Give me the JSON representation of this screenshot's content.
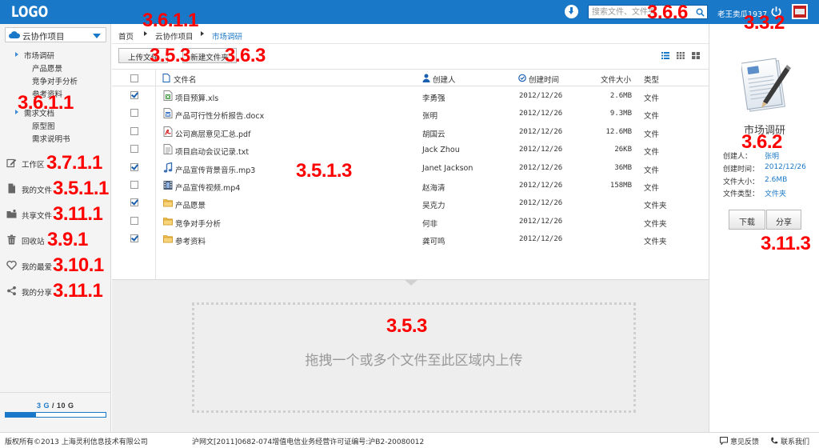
{
  "header": {
    "logo": "LOGO",
    "search_placeholder": "搜索文件、文件夹",
    "user_name": "老王卖瓜1937"
  },
  "sidebar": {
    "project_label": "云协作项目",
    "tree": [
      {
        "label": "市场调研",
        "expanded": true
      },
      {
        "label": "产品愿景"
      },
      {
        "label": "竞争对手分析"
      },
      {
        "label": "参考资料"
      },
      {
        "label": "需求文档",
        "expanded": false
      },
      {
        "label": "原型图"
      },
      {
        "label": "需求说明书"
      }
    ],
    "nav": [
      {
        "label": "工作区",
        "icon": "edit-icon"
      },
      {
        "label": "我的文件",
        "icon": "file-icon"
      },
      {
        "label": "共享文件",
        "icon": "shared-folder-icon"
      },
      {
        "label": "回收站",
        "icon": "trash-icon"
      },
      {
        "label": "我的最爱",
        "icon": "heart-icon"
      },
      {
        "label": "我的分享",
        "icon": "share-icon"
      }
    ],
    "quota_used": "3 G",
    "quota_sep": " / ",
    "quota_total": "10 G",
    "quota_fraction": 0.3
  },
  "breadcrumb": [
    "首页",
    "云协作项目",
    "市场调研"
  ],
  "toolbar": {
    "upload_label": "上传文件",
    "new_folder_label": "新建文件夹"
  },
  "table": {
    "headers": {
      "name": "文件名",
      "creator": "创建人",
      "created": "创建时间",
      "size": "文件大小",
      "type": "类型"
    },
    "rows": [
      {
        "checked": true,
        "icon": "xls",
        "name": "项目预算.xls",
        "creator": "李勇强",
        "date": "2012/12/26",
        "size": "2.6MB",
        "type": "文件"
      },
      {
        "checked": false,
        "icon": "docx",
        "name": "产品可行性分析报告.docx",
        "creator": "张明",
        "date": "2012/12/26",
        "size": "9.3MB",
        "type": "文件"
      },
      {
        "checked": false,
        "icon": "pdf",
        "name": "公司高层意见汇总.pdf",
        "creator": "胡国云",
        "date": "2012/12/26",
        "size": "12.6MB",
        "type": "文件"
      },
      {
        "checked": false,
        "icon": "txt",
        "name": "项目启动会议记录.txt",
        "creator": "Jack Zhou",
        "date": "2012/12/26",
        "size": "26KB",
        "type": "文件"
      },
      {
        "checked": true,
        "icon": "mp3",
        "name": "产品宣传背景音乐.mp3",
        "creator": "Janet Jackson",
        "date": "2012/12/26",
        "size": "36MB",
        "type": "文件"
      },
      {
        "checked": false,
        "icon": "mp4",
        "name": "产品宣传视频.mp4",
        "creator": "赵海清",
        "date": "2012/12/26",
        "size": "158MB",
        "type": "文件"
      },
      {
        "checked": true,
        "icon": "folder",
        "name": "产品愿景",
        "creator": "吴克力",
        "date": "2012/12/26",
        "size": "",
        "type": "文件夹"
      },
      {
        "checked": false,
        "icon": "folder",
        "name": "竞争对手分析",
        "creator": "何非",
        "date": "2012/12/26",
        "size": "",
        "type": "文件夹"
      },
      {
        "checked": true,
        "icon": "folder",
        "name": "参考资料",
        "creator": "龚可鸣",
        "date": "2012/12/26",
        "size": "",
        "type": "文件夹"
      }
    ]
  },
  "dropzone": {
    "text": "拖拽一个或多个文件至此区域内上传"
  },
  "details": {
    "title": "市场调研",
    "creator_label": "创建人：",
    "creator": "张明",
    "created_label": "创建时间：",
    "created": "2012/12/26",
    "size_label": "文件大小：",
    "size": "2.6MB",
    "type_label": "文件类型：",
    "type": "文件夹",
    "download_label": "下载",
    "share_label": "分享"
  },
  "footer": {
    "copyright": "版权所有©2013  上海灵利信息技术有限公司",
    "license": "沪网文[2011]0682-074增值电信业务经营许可证编号:沪B2-20080012",
    "feedback": "意见反馈",
    "contact": "联系我们"
  },
  "annotations": [
    "3.6.1.1",
    "3.6.6",
    "3.3.2",
    "3.5.3",
    "3.6.3",
    "3.6.1.1",
    "3.7.1.1",
    "3.5.1.1",
    "3.11.1",
    "3.9.1",
    "3.10.1",
    "3.11.1",
    "3.5.1.3",
    "3.5.3",
    "3.6.2",
    "3.11.3"
  ]
}
